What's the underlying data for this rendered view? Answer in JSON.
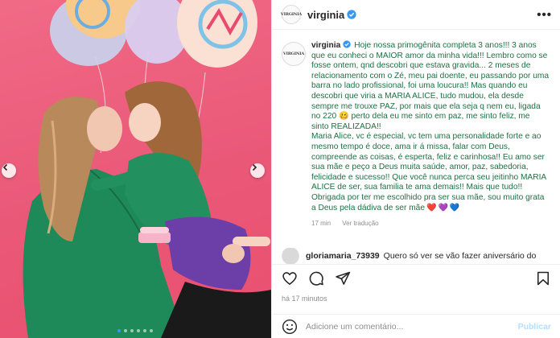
{
  "post": {
    "username": "virginia",
    "avatar_text": "VIRGINIA",
    "more_label": "•••"
  },
  "caption": {
    "username": "virginia",
    "lines": [
      "Hoje nossa primogênita completa 3 anos!!! 3 anos",
      "que eu conheci o MAIOR amor da minha vida!!! Lembro como se",
      "fosse ontem, qnd descobri que estava gravida... 2 meses de",
      "relacionamento com o Zé, meu pai doente, eu passando por uma",
      "barra no lado profissional, foi uma loucura!! Mas quando eu",
      "descobri que viria a MARIA ALICE, tudo mudou, ela desde",
      "sempre me trouxe PAZ, por mais que ela seja q nem eu, ligada",
      "no 220 🥴 perto dela eu me sinto em paz, me sinto feliz, me",
      "sinto REALIZADA!!",
      "Maria Alice, vc é especial, vc tem uma personalidade forte e ao",
      "mesmo tempo é doce, ama ir á missa, falar com Deus,",
      "compreende as coisas, é esperta, feliz e carinhosa!! Eu amo ser",
      "sua mãe e peço a Deus muita saúde, amor, paz, sabedoria,",
      "felicidade e sucesso!! Que você nunca perca seu jeitinho MARIA",
      "ALICE de ser, sua familia te ama demais!! Mais que tudo!!",
      "Obrigada por ter me escolhido pra ser sua mãe, sou muito grata",
      "a Deus pela dádiva de ser mãe"
    ],
    "hearts": [
      "❤️",
      "💜",
      "💙"
    ],
    "time_ago": "17 min",
    "see_translation": "Ver tradução"
  },
  "comment": {
    "username": "gloriamaria_73939",
    "text": "Quero só ver se vão fazer aniversário do"
  },
  "actions": {
    "like": "heart-icon",
    "comment": "comment-icon",
    "share": "share-icon",
    "save": "bookmark-icon"
  },
  "timestamp": "há 17 minutos",
  "comment_bar": {
    "placeholder": "Adicione um comentário...",
    "publish_label": "Publicar"
  },
  "carousel": {
    "slide_count": 6,
    "active_index": 0
  },
  "colors": {
    "caption_text": "#1f6f43",
    "photo_background": "#ea5878",
    "verified_blue": "#3897f0",
    "publish_blue": "#b2dffc"
  }
}
